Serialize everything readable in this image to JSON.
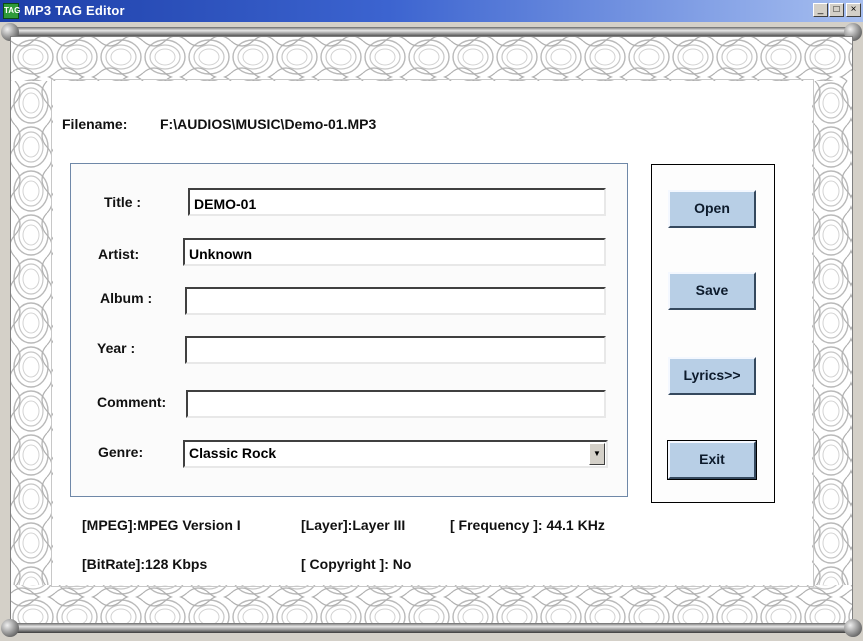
{
  "window": {
    "title": "MP3 TAG Editor",
    "app_icon_text": "TAG",
    "minimize_glyph": "_",
    "maximize_glyph": "□",
    "close_glyph": "×"
  },
  "file": {
    "label": "Filename:",
    "path": "F:\\AUDIOS\\MUSIC\\Demo-01.MP3"
  },
  "form": {
    "title_label": "Title :",
    "title_value": "DEMO-01",
    "artist_label": "Artist:",
    "artist_value": "Unknown",
    "album_label": "Album :",
    "album_value": "",
    "year_label": "Year :",
    "year_value": "",
    "comment_label": "Comment:",
    "comment_value": "",
    "genre_label": "Genre:",
    "genre_value": "Classic Rock",
    "genre_arrow": "▼"
  },
  "buttons": {
    "open": "Open",
    "save": "Save",
    "lyrics": "Lyrics>>",
    "exit": "Exit"
  },
  "info": {
    "mpeg": "[MPEG]:MPEG Version I",
    "layer": "[Layer]:Layer III",
    "frequency": "[ Frequency ]: 44.1 KHz",
    "bitrate": "[BitRate]:128 Kbps",
    "copyright": "[ Copyright ]: No"
  },
  "colors": {
    "titlebar_start": "#1d3fa8",
    "titlebar_end": "#a7bff0",
    "button_face": "#b8cfe6",
    "border_pattern": "#b9b9b9"
  }
}
